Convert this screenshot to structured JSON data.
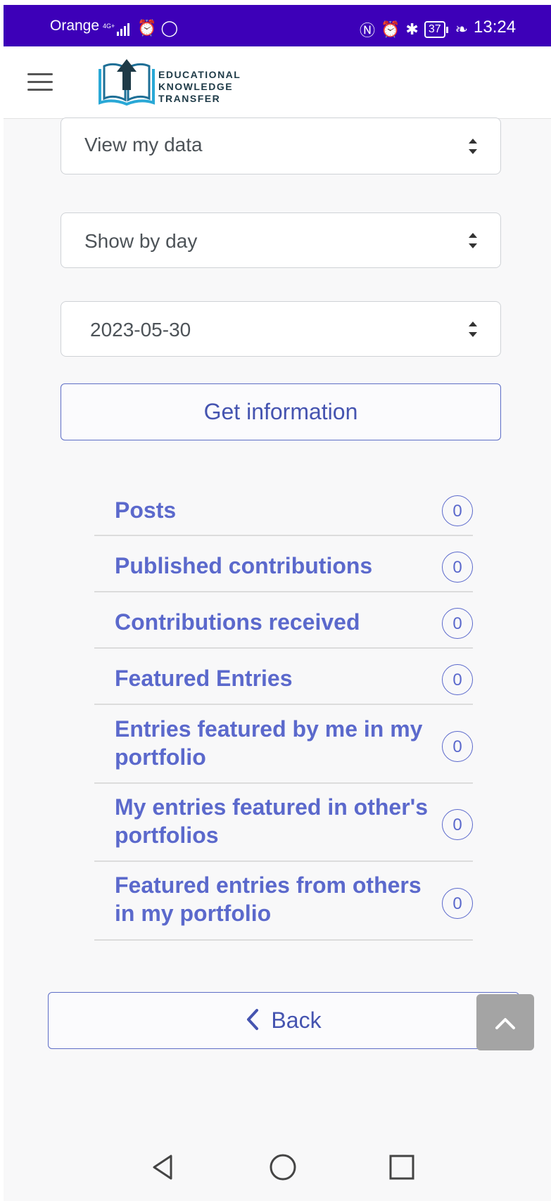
{
  "status_bar": {
    "carrier": "Orange",
    "network": "4G+",
    "battery": "37",
    "time": "13:24"
  },
  "header": {
    "logo_line1": "EDUCATIONAL",
    "logo_line2": "KNOWLEDGE",
    "logo_line3": "TRANSFER"
  },
  "filters": {
    "data_select": "View my data",
    "period_select": "Show by day",
    "date_select": "2023-05-30",
    "get_info_label": "Get information"
  },
  "stats": [
    {
      "label": "Posts",
      "count": "0"
    },
    {
      "label": "Published contributions",
      "count": "0"
    },
    {
      "label": "Contributions received",
      "count": "0"
    },
    {
      "label": "Featured Entries",
      "count": "0"
    },
    {
      "label": "Entries featured by me in my portfolio",
      "count": "0"
    },
    {
      "label": "My entries featured in other's portfolios",
      "count": "0"
    },
    {
      "label": "Featured entries from others in my portfolio",
      "count": "0"
    }
  ],
  "back_label": "Back",
  "icons": {
    "menu": "hamburger-icon",
    "scroll_top": "chevron-up-icon",
    "back": "chevron-left-icon",
    "nav_back": "triangle-back-icon",
    "nav_home": "circle-home-icon",
    "nav_recent": "square-recent-icon"
  },
  "colors": {
    "status_bar": "#3d00b8",
    "accent": "#5b69cc",
    "button_text": "#4554b0"
  }
}
